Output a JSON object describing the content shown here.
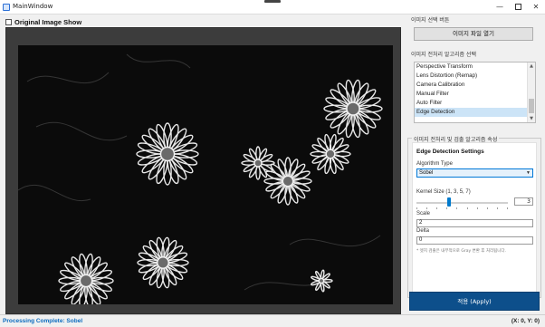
{
  "window": {
    "title": "MainWindow"
  },
  "left": {
    "checkbox_label": "Original Image Show",
    "checkbox_checked": false
  },
  "file_group": {
    "title": "이미지 선택 버튼",
    "open_button": "이미지 파일 열기"
  },
  "algo_group": {
    "title": "이미지 전처리 알고리즘 선택",
    "items": [
      {
        "label": "Perspective Transform",
        "selected": false
      },
      {
        "label": "Lens Distortion (Remap)",
        "selected": false
      },
      {
        "label": "Camera Calibration",
        "selected": false
      },
      {
        "label": "Manual Filter",
        "selected": false
      },
      {
        "label": "Auto Filter",
        "selected": false
      },
      {
        "label": "Edge Detection",
        "selected": true
      }
    ]
  },
  "props": {
    "group_title": "이미지 전처리 및 검출 알고리즘 속성",
    "section_title": "Edge Detection Settings",
    "algorithm_type_label": "Algorithm Type",
    "algorithm_type_value": "Sobel",
    "kernel_label": "Kernel Size (1, 3, 5, 7)",
    "kernel_value": "3",
    "scale_label": "Scale",
    "scale_value": "2",
    "delta_label": "Delta",
    "delta_value": "0",
    "note": "* 엣지 검출은 내부적으로 Gray 변환 후 처리됩니다."
  },
  "apply_button": "적용 (Apply)",
  "status": {
    "message": "Processing Complete: Sobel",
    "coords": "(X: 0, Y: 0)"
  },
  "colors": {
    "accent": "#0078d7",
    "apply_button": "#0d4f8b",
    "status_text": "#0b6bbf",
    "selected_item": "#cce4f7"
  },
  "icons": {
    "minimize": "minimize-icon",
    "maximize": "maximize-icon",
    "close": "close-icon"
  }
}
